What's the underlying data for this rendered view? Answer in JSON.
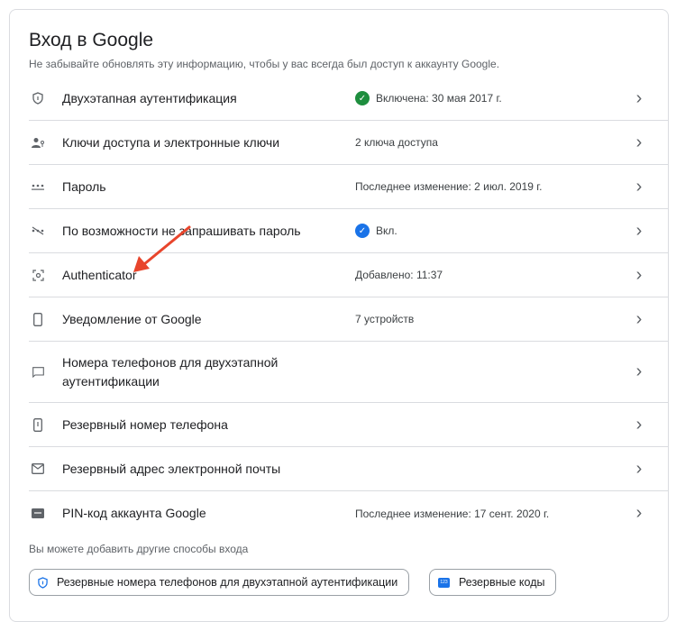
{
  "title": "Вход в Google",
  "subtitle": "Не забывайте обновлять эту информацию, чтобы у вас всегда был доступ к аккаунту Google.",
  "rows": [
    {
      "icon": "shield-icon",
      "label": "Двухэтапная аутентификация",
      "value": "Включена: 30 мая 2017 г.",
      "status": "green-check"
    },
    {
      "icon": "passkey-icon",
      "label": "Ключи доступа и электронные ключи",
      "value": "2 ключа доступа"
    },
    {
      "icon": "password-dots-icon",
      "label": "Пароль",
      "value": "Последнее изменение: 2 июл. 2019 г."
    },
    {
      "icon": "skip-password-icon",
      "label": "По возможности не запрашивать пароль",
      "value": "Вкл.",
      "status": "blue-check"
    },
    {
      "icon": "authenticator-icon",
      "label": "Authenticator",
      "value": "Добавлено: 11:37"
    },
    {
      "icon": "phone-icon",
      "label": "Уведомление от Google",
      "value": "7 устройств"
    },
    {
      "icon": "sms-icon",
      "label": "Номера телефонов для двухэтапной аутентификации",
      "value": ""
    },
    {
      "icon": "phone-alert-icon",
      "label": "Резервный номер телефона",
      "value": ""
    },
    {
      "icon": "mail-icon",
      "label": "Резервный адрес электронной почты",
      "value": ""
    },
    {
      "icon": "pin-icon",
      "label": "PIN-код аккаунта Google",
      "value": "Последнее изменение: 17 сент. 2020 г."
    }
  ],
  "hint": "Вы можете добавить другие способы входа",
  "buttons": {
    "backup_phones": "Резервные номера телефонов для двухэтапной аутентификации",
    "backup_codes": "Резервные коды",
    "codes_icon_text": "123"
  },
  "colors": {
    "green": "#1e8e3e",
    "blue": "#1a73e8",
    "arrow": "#e8452c"
  }
}
